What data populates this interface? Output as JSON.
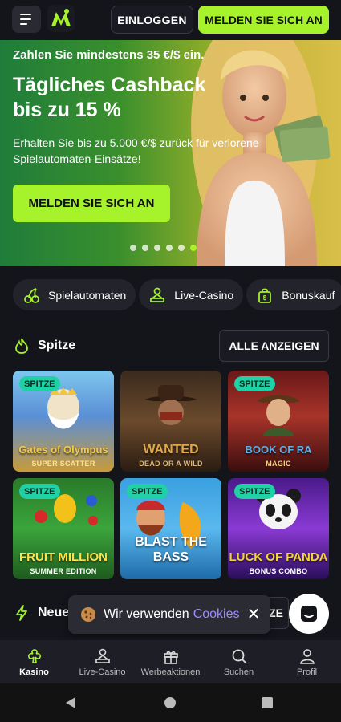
{
  "header": {
    "menu_icon": "hamburger-icon",
    "logo_icon": "brand-logo-icon",
    "login_label": "EINLOGGEN",
    "register_label": "MELDEN SIE SICH AN"
  },
  "hero": {
    "top_text": "Zahlen Sie mindestens 35 €/$ ein.",
    "title": "Tägliches Cashback bis zu 15 %",
    "subtitle": "Erhalten Sie bis zu 5.000 €/$ zurück für verlorene Spielautomaten-Einsätze!",
    "cta_label": "MELDEN SIE SICH AN",
    "slide_count": 6,
    "active_slide": 6
  },
  "categories": [
    {
      "label": "Spielautomaten",
      "icon": "cherries-icon"
    },
    {
      "label": "Live-Casino",
      "icon": "dealer-icon"
    },
    {
      "label": "Bonuskauf",
      "icon": "bonus-bag-icon"
    }
  ],
  "section_top": {
    "title": "Spitze",
    "icon": "flame-icon",
    "all_label": "ALLE ANZEIGEN"
  },
  "games": [
    {
      "name": "Gates of Olympus",
      "sub": "SUPER SCATTER",
      "badge": "SPITZE"
    },
    {
      "name": "WANTED",
      "sub": "DEAD OR A WILD",
      "badge": ""
    },
    {
      "name": "BOOK OF RA",
      "sub": "MAGIC",
      "badge": "SPITZE"
    },
    {
      "name": "FRUIT MILLION",
      "sub": "SUMMER EDITION",
      "badge": "SPITZE"
    },
    {
      "name": "BLAST THE BASS",
      "sub": "",
      "badge": "SPITZE"
    },
    {
      "name": "LUCK OF PANDA",
      "sub": "BONUS COMBO",
      "badge": "SPITZE"
    }
  ],
  "section_new": {
    "title": "Neue",
    "icon": "lightning-icon",
    "all_label": "ANZE"
  },
  "cookie_toast": {
    "text": "Wir verwenden",
    "link": "Cookies",
    "close": "✕"
  },
  "bottom_nav": [
    {
      "label": "Kasino",
      "icon": "club-icon",
      "active": true
    },
    {
      "label": "Live-Casino",
      "icon": "dealer-icon",
      "active": false
    },
    {
      "label": "Werbeaktionen",
      "icon": "gift-icon",
      "active": false
    },
    {
      "label": "Suchen",
      "icon": "search-icon",
      "active": false
    },
    {
      "label": "Profil",
      "icon": "user-icon",
      "active": false
    }
  ],
  "colors": {
    "accent": "#a6f22b",
    "badge": "#1fd1a5",
    "background": "#14141b",
    "cookie_link": "#9d8cff"
  }
}
